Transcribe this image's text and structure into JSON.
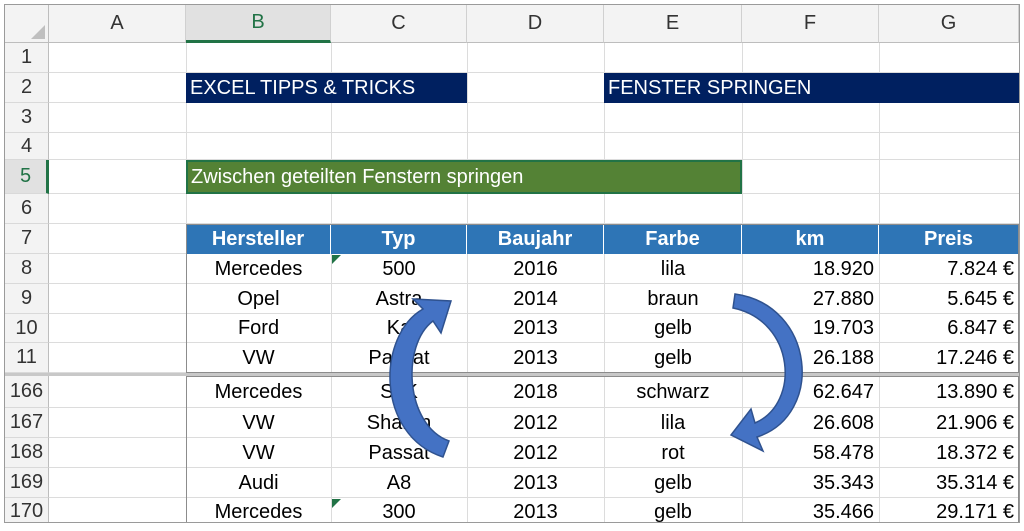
{
  "columns": [
    "A",
    "B",
    "C",
    "D",
    "E",
    "F",
    "G"
  ],
  "selected_column": "B",
  "selected_row": "5",
  "rows_top": [
    "1",
    "2",
    "3",
    "4",
    "5",
    "6",
    "7",
    "8",
    "9",
    "10",
    "11"
  ],
  "rows_bottom": [
    "166",
    "167",
    "168",
    "169",
    "170"
  ],
  "banner_left": "EXCEL TIPPS & TRICKS",
  "banner_right": "FENSTER SPRINGEN",
  "subtitle": "Zwischen geteilten Fenstern springen",
  "table": {
    "headers": [
      "Hersteller",
      "Typ",
      "Baujahr",
      "Farbe",
      "km",
      "Preis"
    ],
    "rows_top": [
      [
        "Mercedes",
        "500",
        "2016",
        "lila",
        "18.920",
        "7.824 €"
      ],
      [
        "Opel",
        "Astra",
        "2014",
        "braun",
        "27.880",
        "5.645 €"
      ],
      [
        "Ford",
        "Ka",
        "2013",
        "gelb",
        "19.703",
        "6.847 €"
      ],
      [
        "VW",
        "Passat",
        "2013",
        "gelb",
        "26.188",
        "17.246 €"
      ]
    ],
    "rows_bottom": [
      [
        "Mercedes",
        "SLK",
        "2018",
        "schwarz",
        "62.647",
        "13.890 €"
      ],
      [
        "VW",
        "Sharan",
        "2012",
        "lila",
        "26.608",
        "21.906 €"
      ],
      [
        "VW",
        "Passat",
        "2012",
        "rot",
        "58.478",
        "18.372 €"
      ],
      [
        "Audi",
        "A8",
        "2013",
        "gelb",
        "35.343",
        "35.314 €"
      ],
      [
        "Mercedes",
        "300",
        "2013",
        "gelb",
        "35.466",
        "29.171 €"
      ]
    ]
  },
  "colors": {
    "banner": "#002060",
    "subtitle": "#548235",
    "table_header": "#2e75b6",
    "arrow": "#4472c4",
    "selection": "#217346"
  },
  "overlay_icons": [
    "curved-arrow-up-icon",
    "curved-arrow-down-icon"
  ]
}
